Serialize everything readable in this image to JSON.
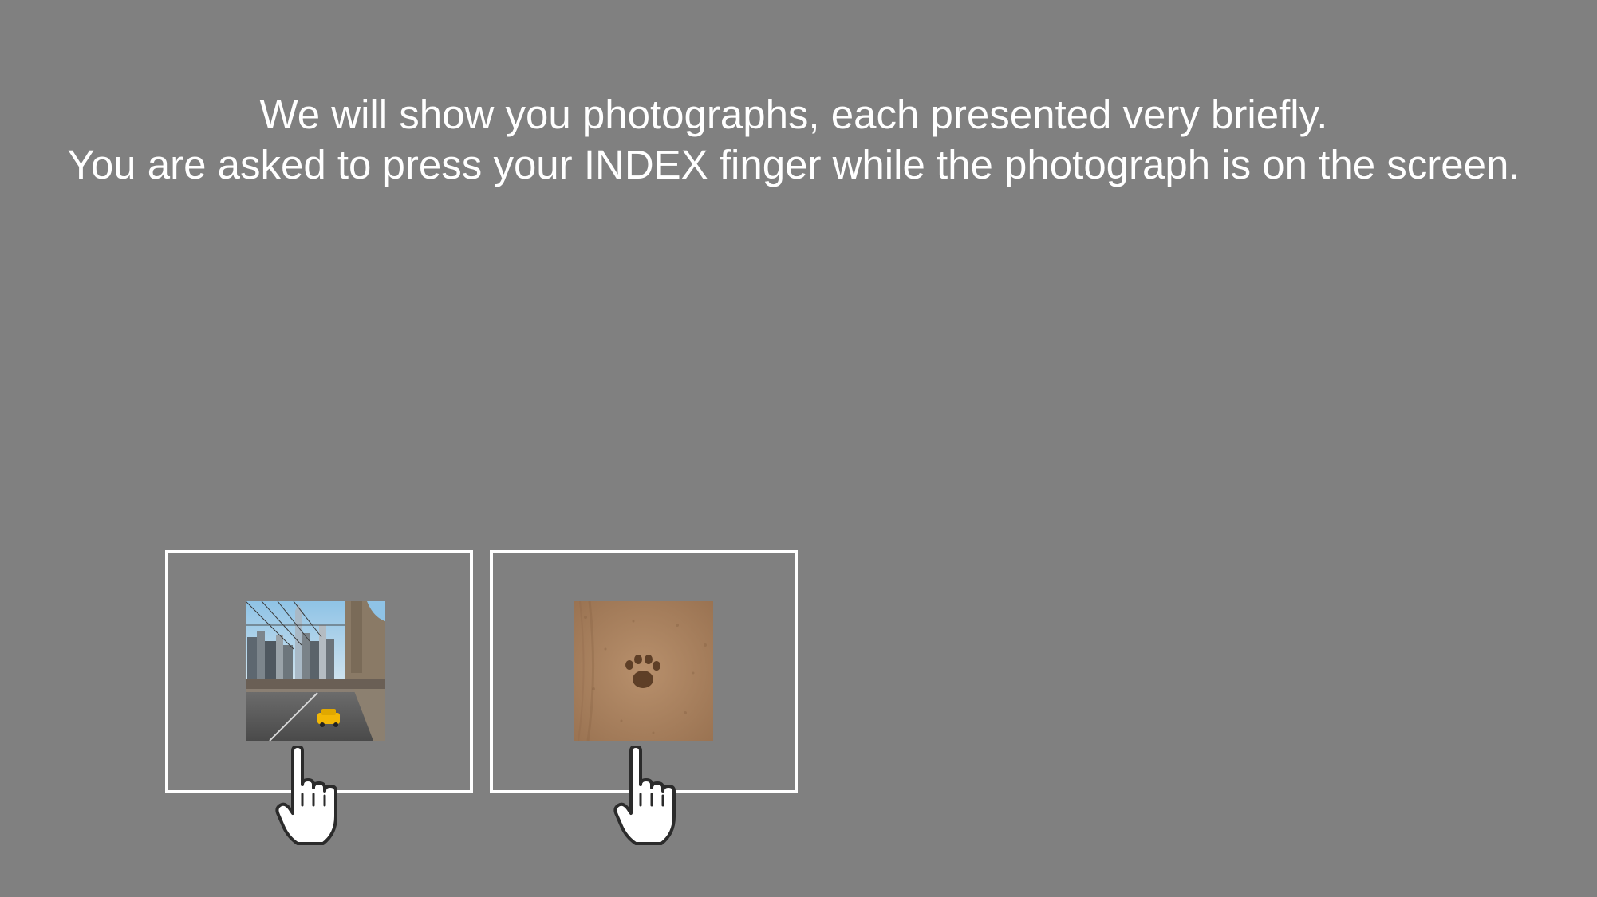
{
  "instructions": {
    "line1": "We will show you photographs, each presented very briefly.",
    "line2": "You are asked to press your INDEX finger while the photograph is on the screen."
  },
  "examples": [
    {
      "photo": "city-bridge-taxi-photo",
      "icon": "pointing-hand-icon"
    },
    {
      "photo": "paw-print-in-sand-photo",
      "icon": "pointing-hand-icon"
    }
  ],
  "colors": {
    "background": "#808080",
    "text": "#ffffff",
    "frame": "#ffffff"
  }
}
